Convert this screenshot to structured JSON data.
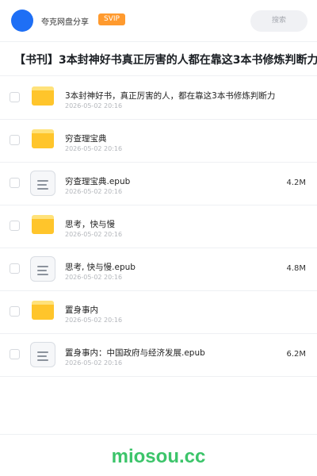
{
  "header": {
    "share_name": "夸克网盘分享",
    "badge": "SVIP",
    "search_label": "搜索",
    "avatar_color": "#1e6ff5"
  },
  "page_title": "【书刊】3本封神好书真正厉害的人都在靠这3本书修炼判断力",
  "files": [
    {
      "type": "folder",
      "icon": "folder-icon",
      "name": "3本封神好书，真正厉害的人，都在靠这3本书修炼判断力",
      "time": "2026-05-02 20:16",
      "size": ""
    },
    {
      "type": "folder",
      "icon": "folder-icon",
      "name": "穷查理宝典",
      "time": "2026-05-02 20:16",
      "size": ""
    },
    {
      "type": "file",
      "icon": "document-icon",
      "name": "穷查理宝典.epub",
      "time": "2026-05-02 20:16",
      "size": "4.2M"
    },
    {
      "type": "folder",
      "icon": "folder-icon",
      "name": "思考，快与慢",
      "time": "2026-05-02 20:16",
      "size": ""
    },
    {
      "type": "file",
      "icon": "document-icon",
      "name": "思考, 快与慢.epub",
      "time": "2026-05-02 20:16",
      "size": "4.8M"
    },
    {
      "type": "folder",
      "icon": "folder-icon",
      "name": "置身事内",
      "time": "2026-05-02 20:16",
      "size": ""
    },
    {
      "type": "file",
      "icon": "document-icon",
      "name": "置身事内：中国政府与经济发展.epub",
      "time": "2026-05-02 20:16",
      "size": "6.2M"
    }
  ],
  "watermark": "miosou.cc",
  "colors": {
    "folder": "#ffc52b",
    "svip_badge": "#ff9a2e",
    "watermark": "#3cc46a"
  }
}
